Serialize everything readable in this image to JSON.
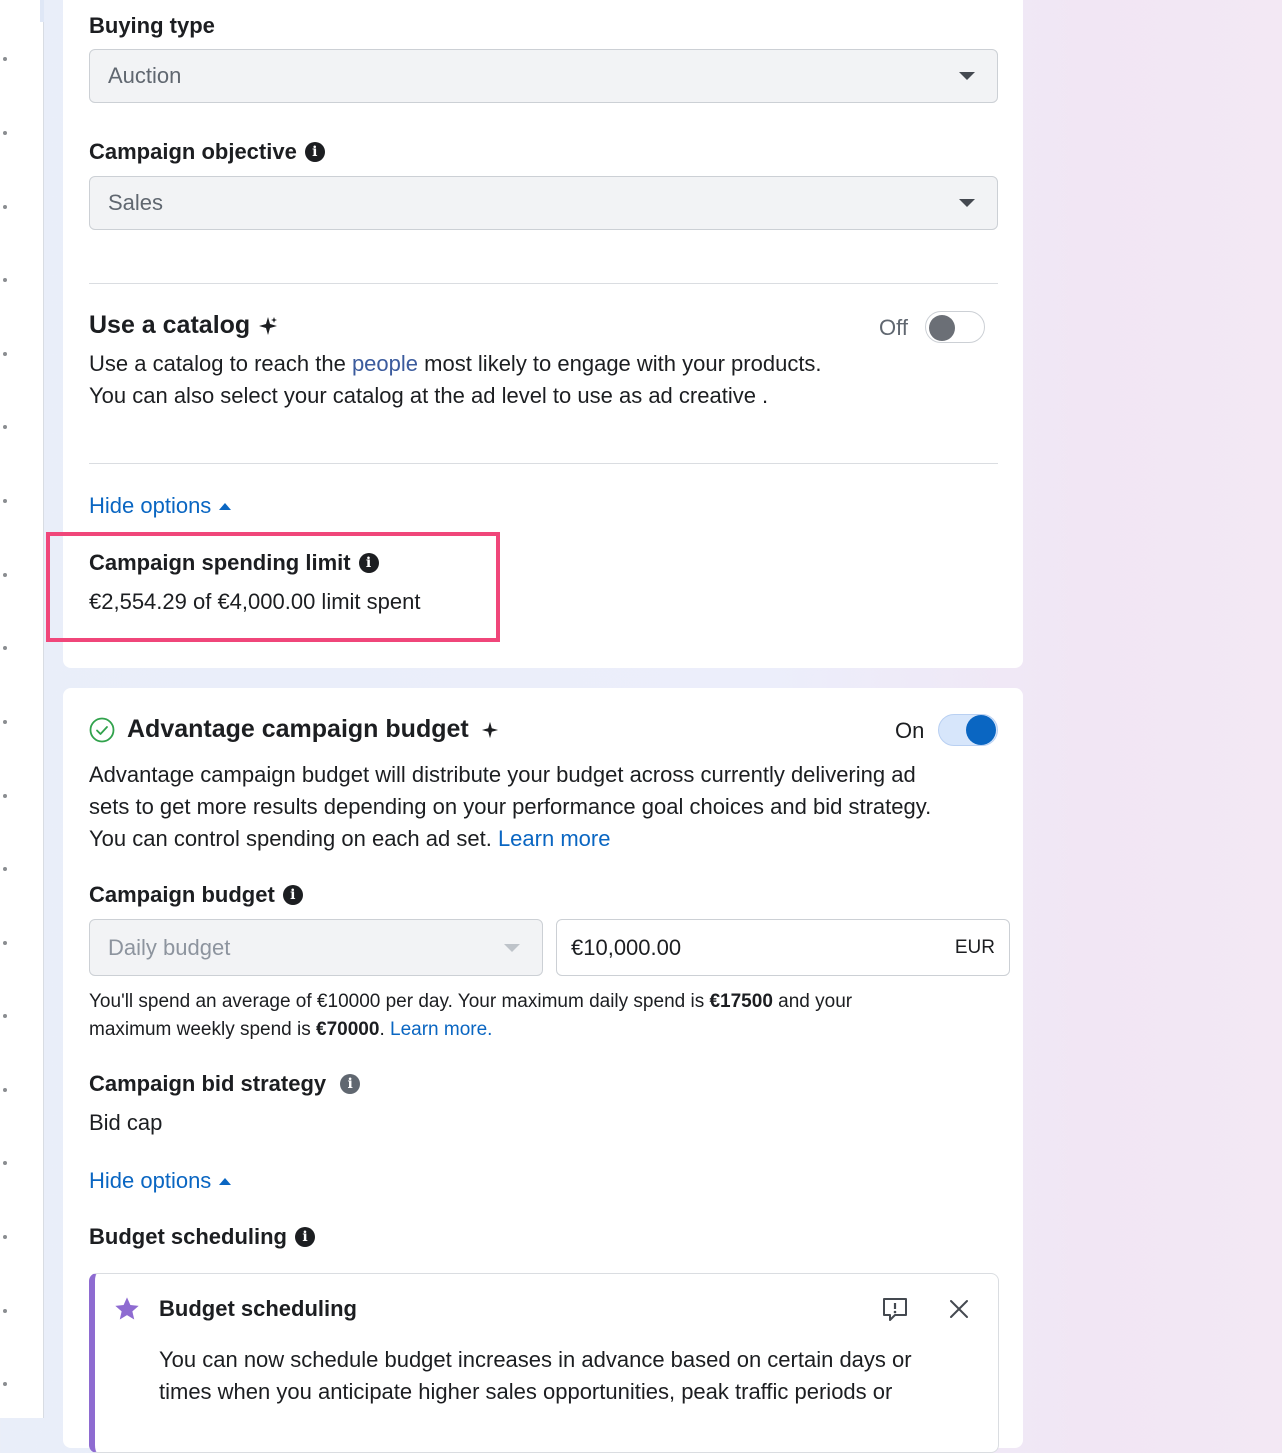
{
  "buying_type": {
    "label": "Buying type",
    "value": "Auction"
  },
  "campaign_objective": {
    "label": "Campaign objective",
    "value": "Sales"
  },
  "catalog": {
    "title": "Use a catalog",
    "toggle_label": "Off",
    "desc_line1_before": "Use a catalog to reach the ",
    "desc_link": "people",
    "desc_line1_after": " most likely to engage with your products.",
    "desc_line2": "You can also select your catalog at the ad level to use as ad creative ."
  },
  "hide_options_1": "Hide options",
  "spending_limit": {
    "label": "Campaign spending limit",
    "value": "€2,554.29 of €4,000.00 limit spent"
  },
  "advantage_budget": {
    "title": "Advantage campaign budget",
    "toggle_label": "On",
    "desc_line1": "Advantage campaign budget will distribute your budget across currently delivering ad",
    "desc_line2": "sets to get more results depending on your performance goal choices and bid strategy.",
    "desc_line3_before": "You can control spending on each ad set. ",
    "learn_more": "Learn more"
  },
  "campaign_budget": {
    "label": "Campaign budget",
    "type_value": "Daily budget",
    "amount": "€10,000.00",
    "currency": "EUR",
    "note_part1": "You'll spend an average of €10000 per day. Your maximum daily spend is ",
    "note_bold1": "€17500",
    "note_part2": " and your",
    "note_part3": "maximum weekly spend is ",
    "note_bold2": "€70000",
    "note_part4": ". ",
    "note_link": "Learn more."
  },
  "bid_strategy": {
    "label": "Campaign bid strategy",
    "value": "Bid cap"
  },
  "hide_options_2": "Hide options",
  "budget_scheduling": {
    "label": "Budget scheduling",
    "notice_title": "Budget scheduling",
    "notice_line1": "You can now schedule budget increases in advance based on certain days or",
    "notice_line2": "times when you anticipate higher sales opportunities, peak traffic periods or"
  },
  "colors": {
    "accent": "#0a66c2",
    "highlight": "#f0467a",
    "notice_border": "#8e6bd1"
  }
}
